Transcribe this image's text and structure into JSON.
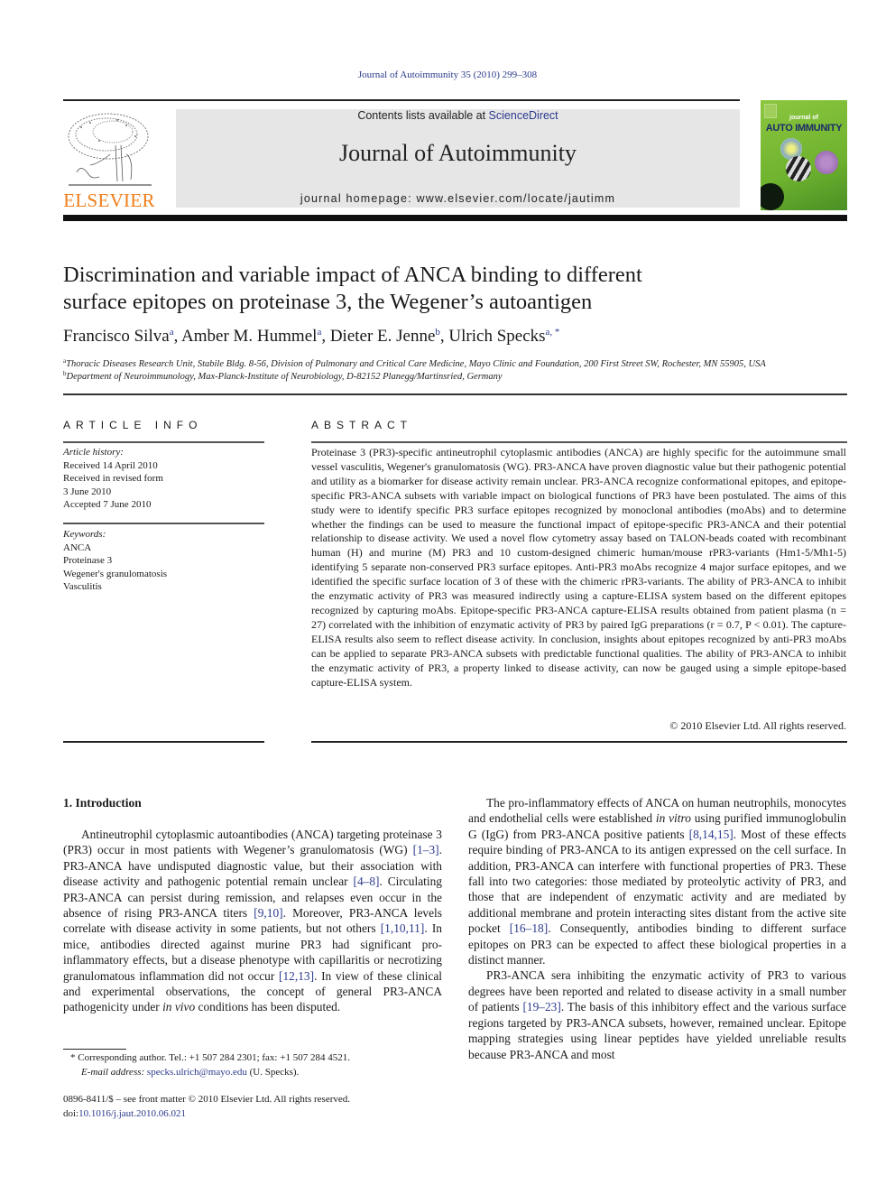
{
  "header": {
    "citation": "Journal of Autoimmunity 35 (2010) 299–308",
    "contents_prefix": "Contents lists available at ",
    "contents_link": "ScienceDirect",
    "journal_title": "Journal of Autoimmunity",
    "homepage": "journal homepage: www.elsevier.com/locate/jautimm",
    "publisher_logo_text": "ELSEVIER",
    "cover_title_small": "journal of",
    "cover_title_big": "AUTO IMMUNITY",
    "colors": {
      "link": "#2b3a8c",
      "elsevier_orange": "#f07d1a",
      "cover_green": "#8cc63f"
    }
  },
  "article": {
    "title_line1": "Discrimination and variable impact of ANCA binding to different",
    "title_line2": "surface epitopes on proteinase 3, the Wegener’s autoantigen",
    "authors": [
      {
        "name": "Francisco Silva",
        "sup": "a",
        "sep": ", "
      },
      {
        "name": "Amber M. Hummel",
        "sup": "a",
        "sep": ", "
      },
      {
        "name": "Dieter E. Jenne",
        "sup": "b",
        "sep": ", "
      },
      {
        "name": "Ulrich Specks",
        "sup": "a, *",
        "sep": ""
      }
    ],
    "affiliations": [
      {
        "sup": "a",
        "text": "Thoracic Diseases Research Unit, Stabile Bldg. 8-56, Division of Pulmonary and Critical Care Medicine, Mayo Clinic and Foundation, 200 First Street SW, Rochester, MN 55905, USA"
      },
      {
        "sup": "b",
        "text": "Department of Neuroimmunology, Max-Planck-Institute of Neurobiology, D-82152 Planegg/Martinsried, Germany"
      }
    ]
  },
  "article_info": {
    "heading": "ARTICLE INFO",
    "history_label": "Article history:",
    "history": [
      "Received 14 April 2010",
      "Received in revised form",
      "3 June 2010",
      "Accepted 7 June 2010"
    ],
    "keywords_label": "Keywords:",
    "keywords": [
      "ANCA",
      "Proteinase 3",
      "Wegener's granulomatosis",
      "Vasculitis"
    ]
  },
  "abstract": {
    "heading": "ABSTRACT",
    "text": "Proteinase 3 (PR3)-specific antineutrophil cytoplasmic antibodies (ANCA) are highly specific for the autoimmune small vessel vasculitis, Wegener's granulomatosis (WG). PR3-ANCA have proven diagnostic value but their pathogenic potential and utility as a biomarker for disease activity remain unclear. PR3-ANCA recognize conformational epitopes, and epitope-specific PR3-ANCA subsets with variable impact on biological functions of PR3 have been postulated. The aims of this study were to identify specific PR3 surface epitopes recognized by monoclonal antibodies (moAbs) and to determine whether the findings can be used to measure the functional impact of epitope-specific PR3-ANCA and their potential relationship to disease activity. We used a novel flow cytometry assay based on TALON-beads coated with recombinant human (H) and murine (M) PR3 and 10 custom-designed chimeric human/mouse rPR3-variants (Hm1-5/Mh1-5) identifying 5 separate non-conserved PR3 surface epitopes. Anti-PR3 moAbs recognize 4 major surface epitopes, and we identified the specific surface location of 3 of these with the chimeric rPR3-variants. The ability of PR3-ANCA to inhibit the enzymatic activity of PR3 was measured indirectly using a capture-ELISA system based on the different epitopes recognized by capturing moAbs. Epitope-specific PR3-ANCA capture-ELISA results obtained from patient plasma (n = 27) correlated with the inhibition of enzymatic activity of PR3 by paired IgG preparations (r = 0.7, P < 0.01). The capture-ELISA results also seem to reflect disease activity. In conclusion, insights about epitopes recognized by anti-PR3 moAbs can be applied to separate PR3-ANCA subsets with predictable functional qualities. The ability of PR3-ANCA to inhibit the enzymatic activity of PR3, a property linked to disease activity, can now be gauged using a simple epitope-based capture-ELISA system.",
    "copyright": "© 2010 Elsevier Ltd. All rights reserved."
  },
  "introduction": {
    "heading": "1.  Introduction",
    "left_paragraph": [
      {
        "t": "Antineutrophil cytoplasmic autoantibodies (ANCA) targeting proteinase 3 (PR3) occur in most patients with Wegener’s granulomatosis (WG) "
      },
      {
        "ref": "[1–3]"
      },
      {
        "t": ". PR3-ANCA have undisputed diagnostic value, but their association with disease activity and pathogenic potential remain unclear "
      },
      {
        "ref": "[4–8]"
      },
      {
        "t": ". Circulating PR3-ANCA can persist during remission, and relapses even occur in the absence of rising PR3-ANCA titers "
      },
      {
        "ref": "[9,10]"
      },
      {
        "t": ". Moreover, PR3-ANCA levels correlate with disease activity in some patients, but not others "
      },
      {
        "ref": "[1,10,11]"
      },
      {
        "t": ". In mice, antibodies directed against murine PR3 had significant pro-inflammatory effects, but a disease phenotype with capillaritis or necrotizing granulomatous inflammation did not occur "
      },
      {
        "ref": "[12,13]"
      },
      {
        "t": ". In view of these clinical and experimental observations, the concept of general PR3-ANCA pathogenicity under "
      },
      {
        "i": "in vivo"
      },
      {
        "t": " conditions has been disputed."
      }
    ],
    "right_paragraph_1": [
      {
        "t": "The pro-inflammatory effects of ANCA on human neutrophils, monocytes and endothelial cells were established "
      },
      {
        "i": "in vitro"
      },
      {
        "t": " using purified immunoglobulin G (IgG) from PR3-ANCA positive patients "
      },
      {
        "ref": "[8,14,15]"
      },
      {
        "t": ". Most of these effects require binding of PR3-ANCA to its antigen expressed on the cell surface. In addition, PR3-ANCA can interfere with functional properties of PR3. These fall into two categories: those mediated by proteolytic activity of PR3, and those that are independent of enzymatic activity and are mediated by additional membrane and protein interacting sites distant from the active site pocket "
      },
      {
        "ref": "[16–18]"
      },
      {
        "t": ". Consequently, antibodies binding to different surface epitopes on PR3 can be expected to affect these biological properties in a distinct manner."
      }
    ],
    "right_paragraph_2": [
      {
        "t": "PR3-ANCA sera inhibiting the enzymatic activity of PR3 to various degrees have been reported and related to disease activity in a small number of patients "
      },
      {
        "ref": "[19–23]"
      },
      {
        "t": ". The basis of this inhibitory effect and the various surface regions targeted by PR3-ANCA subsets, however, remained unclear. Epitope mapping strategies using linear peptides have yielded unreliable results because PR3-ANCA and most"
      }
    ]
  },
  "footnotes": {
    "corresponding": "*  Corresponding author. Tel.: +1 507 284 2301; fax: +1 507 284 4521.",
    "email_label": "E-mail address: ",
    "email": "specks.ulrich@mayo.edu",
    "email_suffix": " (U. Specks).",
    "issn_line": "0896-8411/$ – see front matter © 2010 Elsevier Ltd. All rights reserved.",
    "doi_prefix": "doi:",
    "doi": "10.1016/j.jaut.2010.06.021"
  }
}
